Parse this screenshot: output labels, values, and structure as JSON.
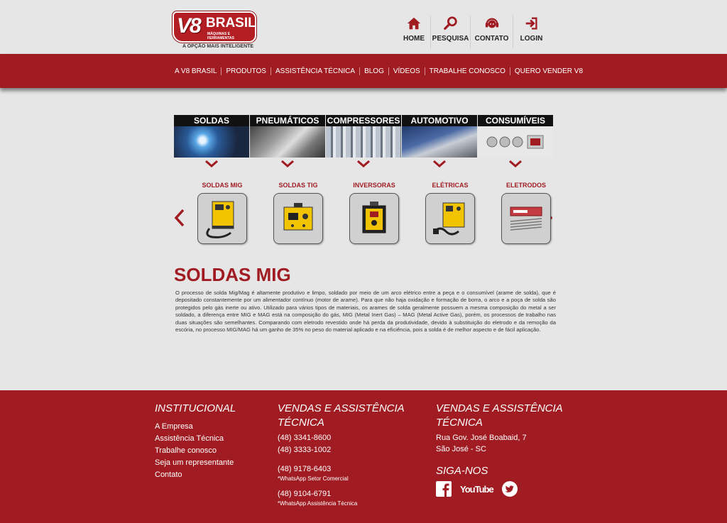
{
  "brand": {
    "logo_main": "V8",
    "logo_name": "BRASIL",
    "logo_sub": "MÁQUINAS E FERRAMENTAS",
    "tagline": "A OPÇÃO MAIS INTELIGENTE",
    "color_red": "#a01c22"
  },
  "topnav": [
    {
      "label": "HOME",
      "icon": "home-icon"
    },
    {
      "label": "PESQUISA",
      "icon": "search-icon"
    },
    {
      "label": "CONTATO",
      "icon": "headset-icon"
    },
    {
      "label": "LOGIN",
      "icon": "login-icon"
    }
  ],
  "mainnav": [
    "A V8 BRASIL",
    "PRODUTOS",
    "ASSISTÊNCIA TÉCNICA",
    "BLOG",
    "VÍDEOS",
    "TRABALHE CONOSCO",
    "QUERO VENDER V8"
  ],
  "categories": [
    "SOLDAS",
    "PNEUMÁTICOS",
    "COMPRESSORES",
    "AUTOMOTIVO",
    "CONSUMÍVEIS"
  ],
  "products": [
    "SOLDAS MIG",
    "SOLDAS TIG",
    "INVERSORAS",
    "ELÉTRICAS",
    "ELETRODOS"
  ],
  "content": {
    "title": "SOLDAS MIG",
    "text": "O processo de solda Mig/Mag é altamente produtivo e limpo, soldado por meio de um arco elétrico entre a peça e o consumível (arame de solda), que é depositado constantemente por um alimentador contínuo (motor de arame). Para que não haja oxidação e formação de borra, o arco e a poça de solda são protegidos pelo gás inerte ou ativo. Utilizado para vários tipos de materiais, os arames de solda geralmente possuem a mesma composição do metal a ser soldado, a diferença entre MIG e MAG está na composição do gás, MIG (Metal Inert Gas) – MAG (Metal Active Gas), porém, os processos de trabalho nas duas situações são semelhantes. Comparando com eletrodo revestido onde há perda da produtividade, devido à substituição do eletrodo e da remoção da escória, no processo MIG/MAG há um ganho de 35% no peso do material aplicado e na eficiência, pois a solda é de melhor aspecto e de fácil aplicação."
  },
  "footer": {
    "institucional": {
      "title": "INSTITUCIONAL",
      "links": [
        "A Empresa",
        "Assistência Técnica",
        "Trabalhe conosco",
        "Seja um representante",
        "Contato"
      ]
    },
    "vendas": {
      "title": "VENDAS E ASSISTÊNCIA TÉCNICA",
      "phone1": "(48) 3341-8600",
      "phone2": "(48) 3333-1002",
      "phone3": "(48) 9178-6403",
      "note3": "*WhatsApp Setor Comercial",
      "phone4": "(48) 9104-6791",
      "note4": "*WhatsApp Assistência Técnica"
    },
    "endereco": {
      "title": "VENDAS E ASSISTÊNCIA TÉCNICA",
      "line1": "Rua Gov. José Boabaid, 7",
      "line2": "São José - SC"
    },
    "social": {
      "title": "SIGA-NOS",
      "youtube_label": "YouTube",
      "icons": [
        "facebook-icon",
        "youtube-icon",
        "twitter-icon"
      ]
    }
  }
}
